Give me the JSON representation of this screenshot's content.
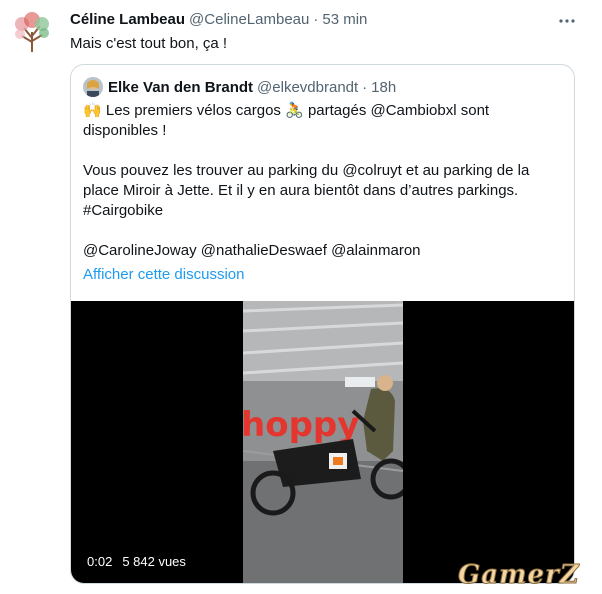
{
  "tweet": {
    "author_name": "Céline Lambeau",
    "author_handle": "@CelineLambeau",
    "separator": "·",
    "time": "53 min",
    "text": "Mais c'est tout bon, ça !",
    "more_icon": "ellipsis-icon"
  },
  "quote": {
    "author_name": "Elke Van den Brandt",
    "author_handle": "@elkevdbrandt",
    "separator": "·",
    "time": "18h",
    "line1_emoji": "🙌",
    "line1_a": " Les premiers vélos cargos ",
    "line1_emoji2": "🚴",
    "line1_b": " partagés @Cambiobxl sont disponibles !",
    "para2": "Vous pouvez les trouver au parking du @colruyt et au parking de la place Miroir à Jette. Et il y en aura bientôt dans d’autres parkings.",
    "hashtag": "#Cairgobike",
    "mentions": "@CarolineJoway @nathalieDeswaef @alainmaron",
    "show_thread": "Afficher cette discussion"
  },
  "video": {
    "elapsed": "0:02",
    "views": "5 842 vues",
    "sign_text": "hoppy"
  },
  "watermark": "GamerZ"
}
